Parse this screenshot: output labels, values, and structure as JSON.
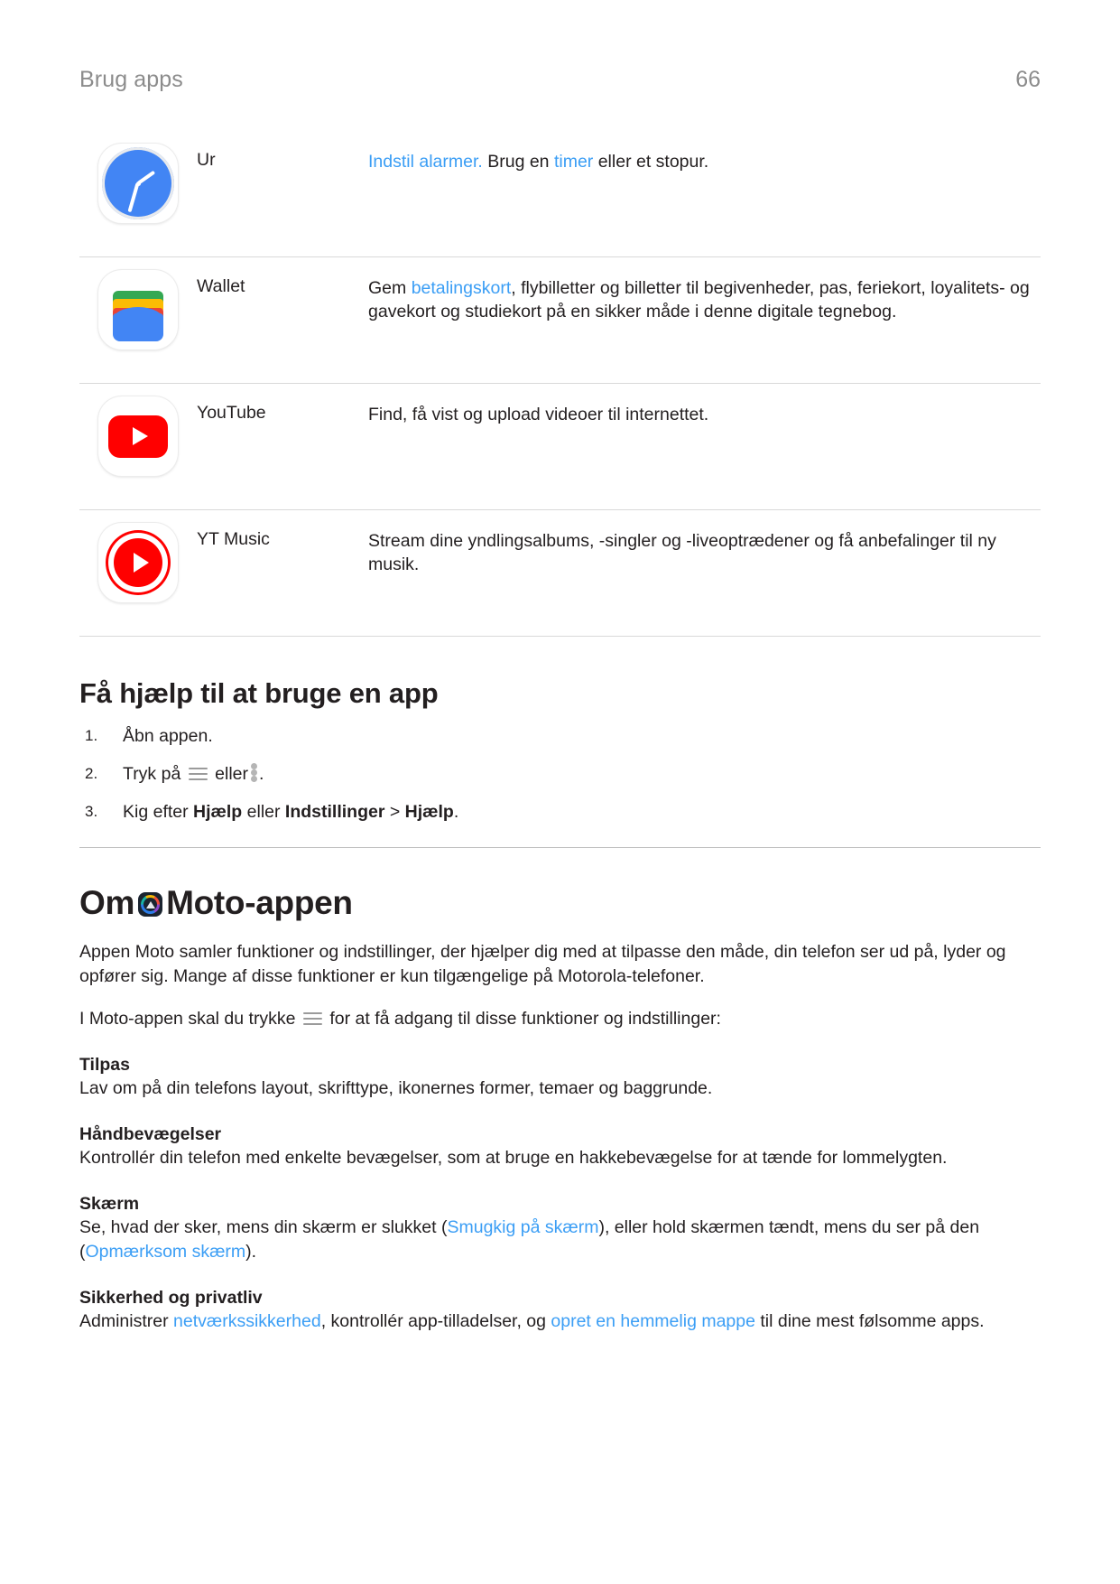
{
  "header": {
    "chapter": "Brug apps",
    "page_number": "66"
  },
  "app_table": {
    "rows": [
      {
        "icon": "clock-app-icon",
        "name": "Ur",
        "desc_parts": [
          {
            "text": "Indstil alarmer.",
            "link": true
          },
          {
            "text": " Brug en ",
            "link": false
          },
          {
            "text": "timer",
            "link": true
          },
          {
            "text": " eller et stopur.",
            "link": false
          }
        ]
      },
      {
        "icon": "wallet-app-icon",
        "name": "Wallet",
        "desc_parts": [
          {
            "text": "Gem ",
            "link": false
          },
          {
            "text": "betalingskort",
            "link": true
          },
          {
            "text": ", flybilletter og billetter til begivenheder, pas, feriekort, loyalitets- og gavekort og studiekort på en sikker måde i denne digitale tegnebog.",
            "link": false
          }
        ]
      },
      {
        "icon": "youtube-app-icon",
        "name": "YouTube",
        "desc_parts": [
          {
            "text": "Find, få vist og upload videoer til internettet.",
            "link": false
          }
        ]
      },
      {
        "icon": "yt-music-app-icon",
        "name": "YT Music",
        "desc_parts": [
          {
            "text": "Stream dine yndlingsalbums, -singler og -liveoptrædener og få anbefalinger til ny musik.",
            "link": false
          }
        ]
      }
    ]
  },
  "help_section": {
    "title": "Få hjælp til at bruge en app",
    "steps": [
      {
        "parts": [
          {
            "text": "Åbn appen.",
            "style": "normal"
          }
        ]
      },
      {
        "parts": [
          {
            "text": "Tryk på ",
            "style": "normal"
          },
          {
            "text": "hamburger-menu-icon",
            "style": "icon-hamburger"
          },
          {
            "text": " eller",
            "style": "normal"
          },
          {
            "text": "kebab-menu-icon",
            "style": "icon-kebab"
          },
          {
            "text": ".",
            "style": "normal"
          }
        ]
      },
      {
        "parts": [
          {
            "text": "Kig efter ",
            "style": "normal"
          },
          {
            "text": "Hjælp",
            "style": "bold"
          },
          {
            "text": " eller ",
            "style": "normal"
          },
          {
            "text": "Indstillinger",
            "style": "bold"
          },
          {
            "text": " > ",
            "style": "normal"
          },
          {
            "text": "Hjælp",
            "style": "bold"
          },
          {
            "text": ".",
            "style": "normal"
          }
        ]
      }
    ]
  },
  "moto_section": {
    "title_before": "Om",
    "title_icon": "moto-logo-icon",
    "title_after": "Moto-appen",
    "intro": "Appen Moto samler funktioner og indstillinger, der hjælper dig med at tilpasse den måde, din telefon ser ud på, lyder og opfører sig. Mange af disse funktioner er kun tilgængelige på Motorola-telefoner.",
    "access_before": "I Moto-appen skal du trykke ",
    "access_icon": "hamburger-menu-icon",
    "access_after": " for at få adgang til disse funktioner og indstillinger:",
    "features": [
      {
        "title": "Tilpas",
        "parts": [
          {
            "text": "Lav om på din telefons layout, skrifttype, ikonernes former, temaer og baggrunde.",
            "link": false
          }
        ]
      },
      {
        "title": "Håndbevægelser",
        "parts": [
          {
            "text": "Kontrollér din telefon med enkelte bevægelser, som at bruge en hakkebevægelse for at tænde for lommelygten.",
            "link": false
          }
        ]
      },
      {
        "title": "Skærm",
        "parts": [
          {
            "text": "Se, hvad der sker, mens din skærm er slukket (",
            "link": false
          },
          {
            "text": "Smugkig på skærm",
            "link": true
          },
          {
            "text": "), eller hold skærmen tændt, mens du ser på den (",
            "link": false
          },
          {
            "text": "Opmærksom skærm",
            "link": true
          },
          {
            "text": ").",
            "link": false
          }
        ]
      },
      {
        "title": "Sikkerhed og privatliv",
        "parts": [
          {
            "text": "Administrer ",
            "link": false
          },
          {
            "text": "netværkssikkerhed",
            "link": true
          },
          {
            "text": ", kontrollér app-tilladelser, og ",
            "link": false
          },
          {
            "text": "opret en hemmelig mappe",
            "link": true
          },
          {
            "text": " til dine mest følsomme apps.",
            "link": false
          }
        ]
      }
    ]
  },
  "colors": {
    "link": "#3b9ef5",
    "text": "#231f20",
    "header_gray": "#8c8c8c",
    "rule": "#d9d9d9"
  }
}
